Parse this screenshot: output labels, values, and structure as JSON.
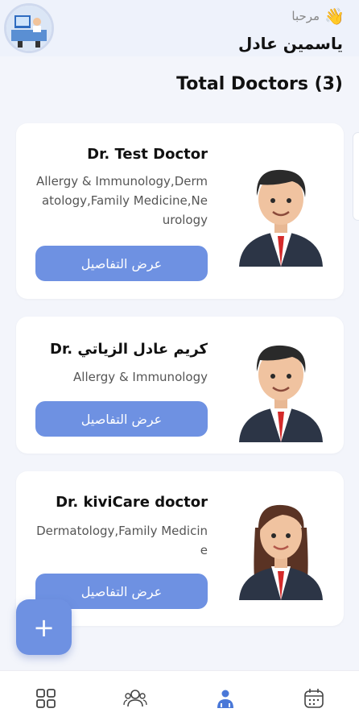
{
  "header": {
    "greeting": "مرحبا",
    "greeting_icon": "waving-hand-icon",
    "user_name": "ياسمين عادل"
  },
  "main": {
    "title": "Total Doctors (3)",
    "doctors": [
      {
        "name": "Dr. Test Doctor",
        "specialty": "Allergy & Immunology,Dermatology,Family Medicine,Neurology",
        "button_label": "عرض التفاصيل",
        "avatar": "male-doctor-avatar"
      },
      {
        "name": "Dr. كريم عادل الزياتي",
        "specialty": "Allergy & Immunology",
        "button_label": "عرض التفاصيل",
        "avatar": "male-doctor-avatar"
      },
      {
        "name": "Dr. kiviCare doctor",
        "specialty": "Dermatology,Family Medicine",
        "button_label": "عرض التفاصيل",
        "avatar": "female-doctor-avatar"
      }
    ]
  },
  "fab": {
    "label": "+"
  },
  "bottom_nav": {
    "items": [
      "dashboard-grid-icon",
      "patients-icon",
      "doctors-icon",
      "calendar-icon"
    ],
    "active_index": 2
  },
  "colors": {
    "accent": "#6e91e2",
    "background": "#f3f5fb",
    "header_background": "#eef2fb"
  }
}
